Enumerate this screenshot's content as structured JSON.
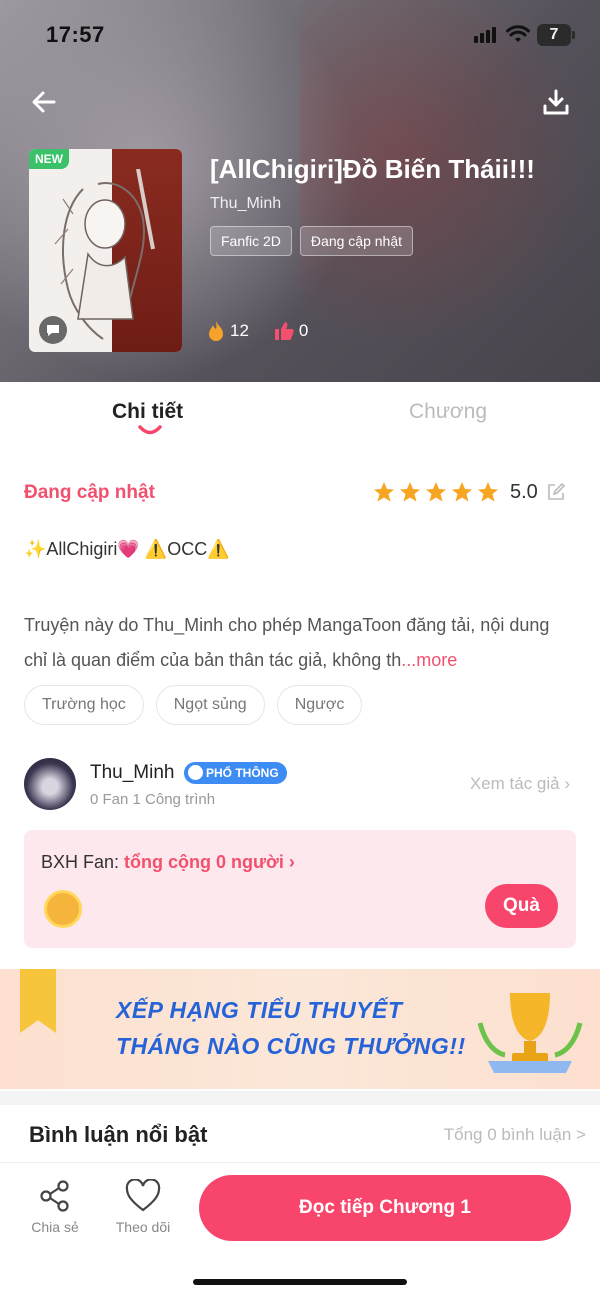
{
  "status_bar": {
    "time": "17:57",
    "battery": "7"
  },
  "header": {
    "cover_badge": "NEW",
    "title": "[AllChigiri]Đồ Biến Tháii!!!",
    "author": "Thu_Minh",
    "tags": [
      "Fanfic 2D",
      "Đang cập nhật"
    ],
    "fire_count": "12",
    "like_count": "0"
  },
  "tabs": {
    "details": "Chi tiết",
    "chapters": "Chương"
  },
  "details": {
    "status": "Đang cập nhật",
    "rating": "5.0",
    "rating_stars": 5,
    "headline": "✨AllChigiri💗 ⚠️OCC⚠️",
    "description": "Truyện này do Thu_Minh cho phép MangaToon đăng tải, nội dung chỉ là quan điểm của bản thân tác giả, không th",
    "more": "...more",
    "genres": [
      "Trường học",
      "Ngọt sủng",
      "Ngược"
    ]
  },
  "author_card": {
    "name": "Thu_Minh",
    "badge": "PHỔ THÔNG",
    "meta": "0 Fan   1 Công trình",
    "see_author": "Xem tác giả ›"
  },
  "fan_board": {
    "label": "BXH Fan: ",
    "value": "tổng cộng 0 người ›",
    "gift_button": "Quà"
  },
  "banner": {
    "line1": "XẾP HẠNG TIỂU THUYẾT",
    "line2": "THÁNG NÀO CŨNG THƯỞNG!!"
  },
  "comments": {
    "title": "Bình luận nổi bật",
    "total": "Tổng 0 bình luận >"
  },
  "bottom_bar": {
    "share": "Chia sẻ",
    "follow": "Theo dõi",
    "read": "Đọc tiếp Chương 1"
  },
  "colors": {
    "accent": "#f7456b",
    "accent_text": "#f2506f",
    "badge_blue": "#3d8cf3",
    "banner_blue": "#2663d8"
  }
}
